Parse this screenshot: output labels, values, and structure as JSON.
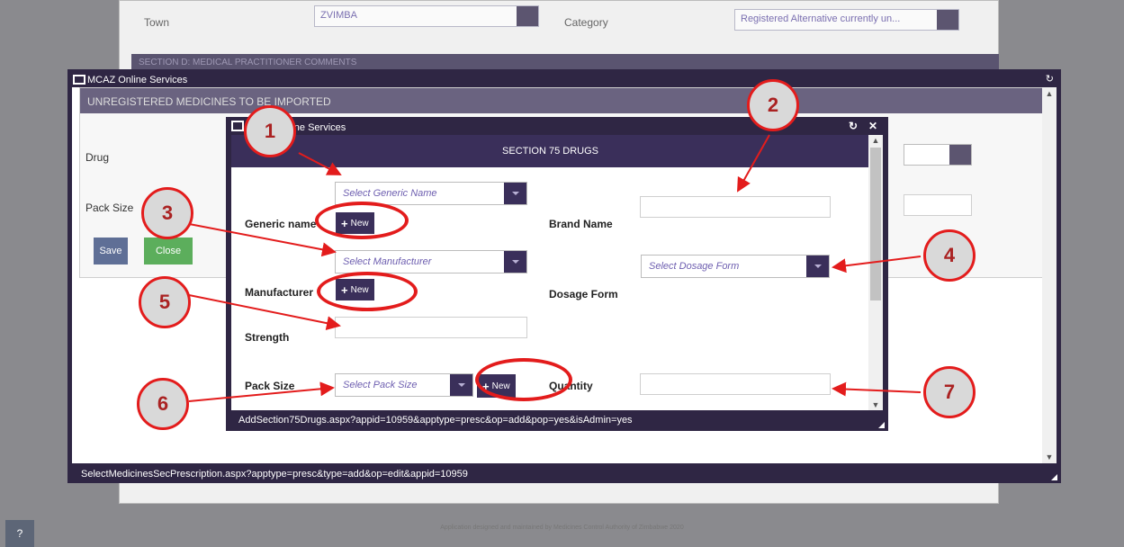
{
  "background": {
    "town_label": "Town",
    "town_value": "ZVIMBA",
    "category_label": "Category",
    "category_value": "Registered Alternative currently un...",
    "section_bar": "SECTION D: MEDICAL PRACTITIONER COMMENTS",
    "footer": "Application designed and maintained by Medicines Control Authority of Zimbabwe 2020",
    "help_icon": "?"
  },
  "outer_window": {
    "title": "MCAZ Online Services",
    "refresh_icon": "↻",
    "status_url": "SelectMedicinesSecPrescription.aspx?apptype=presc&type=add&op=edit&appid=10959",
    "panel": {
      "header": "UNREGISTERED MEDICINES TO BE IMPORTED",
      "drug_label": "Drug",
      "pack_size_label": "Pack Size",
      "save_label": "Save",
      "close_label": "Close"
    }
  },
  "inner_window": {
    "title": "MCAZ Online Services",
    "refresh_icon": "↻",
    "close_icon": "✕",
    "section_title": "SECTION 75 DRUGS",
    "status_url": "AddSection75Drugs.aspx?appid=10959&apptype=presc&op=add&pop=yes&isAdmin=yes",
    "form": {
      "generic_name_label": "Generic name",
      "generic_name_placeholder": "Select Generic Name",
      "brand_name_label": "Brand Name",
      "manufacturer_label": "Manufacturer",
      "manufacturer_placeholder": "Select Manufacturer",
      "dosage_form_label": "Dosage Form",
      "dosage_form_placeholder": "Select Dosage Form",
      "strength_label": "Strength",
      "pack_size_label": "Pack Size",
      "pack_size_placeholder": "Select Pack Size",
      "quantity_label": "Quantity",
      "new_label": "New",
      "plus": "+"
    }
  },
  "annotations": [
    "1",
    "2",
    "3",
    "4",
    "5",
    "6",
    "7"
  ],
  "colors": {
    "window_frame": "#2f2644",
    "section_header": "#3a2f5a",
    "annotation_red": "#e31c1c",
    "annotation_fill": "#d9d9d9"
  }
}
